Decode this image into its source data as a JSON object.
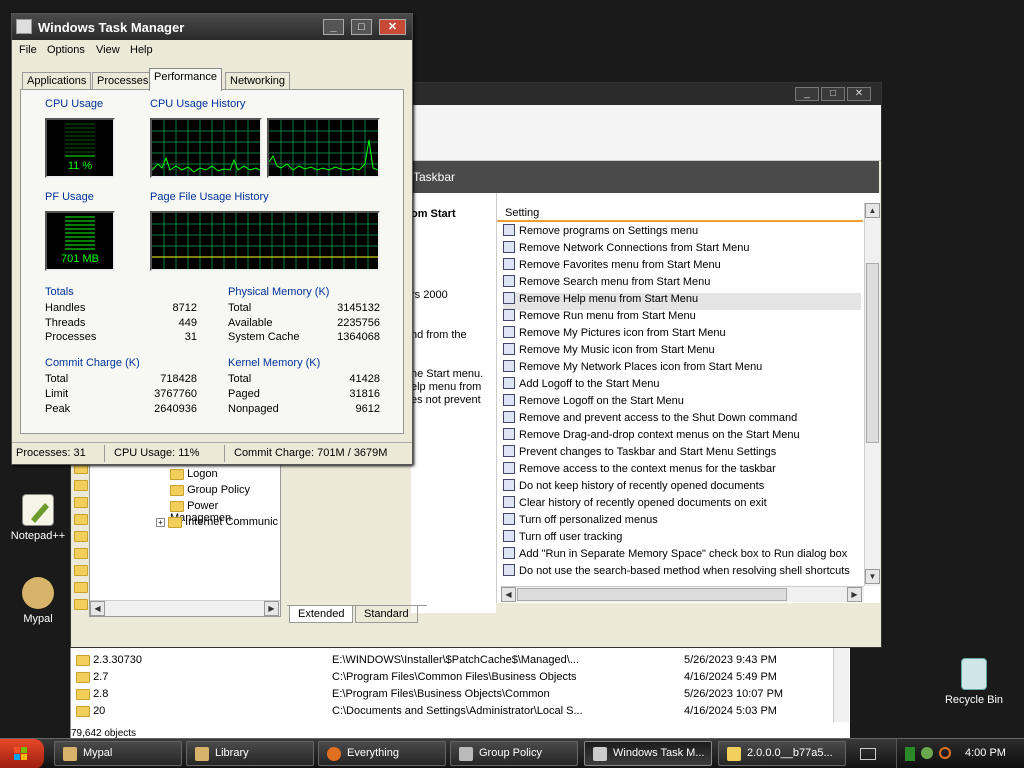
{
  "desktop": {
    "icons": [
      {
        "label": "Notepad++"
      },
      {
        "label": "Mypal"
      },
      {
        "label": "Recycle Bin"
      }
    ]
  },
  "explorer": {
    "rows": [
      {
        "name": "2.3.30730",
        "path": "E:\\WINDOWS\\Installer\\$PatchCache$\\Managed\\...",
        "date": "5/26/2023 9:43 PM"
      },
      {
        "name": "2.7",
        "path": "C:\\Program Files\\Common Files\\Business Objects",
        "date": "4/16/2024 5:49 PM"
      },
      {
        "name": "2.8",
        "path": "E:\\Program Files\\Business Objects\\Common",
        "date": "5/26/2023 10:07 PM"
      },
      {
        "name": "20",
        "path": "C:\\Documents and Settings\\Administrator\\Local S...",
        "date": "4/16/2024 5:03 PM"
      }
    ],
    "status": "79,642 objects"
  },
  "gpe": {
    "header": "Taskbar",
    "desc_fragments": [
      "om Start",
      "rs 2000",
      "nd from the",
      "he Start menu.",
      "elp menu from",
      "es not prevent"
    ],
    "column_setting": "Setting",
    "settings": [
      "Remove programs on Settings menu",
      "Remove Network Connections from Start Menu",
      "Remove Favorites menu from Start Menu",
      "Remove Search menu from Start Menu",
      "Remove Help menu from Start Menu",
      "Remove Run menu from Start Menu",
      "Remove My Pictures icon from Start Menu",
      "Remove My Music icon from Start Menu",
      "Remove My Network Places icon from Start Menu",
      "Add Logoff to the Start Menu",
      "Remove Logoff on the Start Menu",
      "Remove and prevent access to the Shut Down command",
      "Remove Drag-and-drop context menus on the Start Menu",
      "Prevent changes to Taskbar and Start Menu Settings",
      "Remove access to the context menus for the taskbar",
      "Do not keep history of recently opened documents",
      "Clear history of recently opened documents on exit",
      "Turn off personalized menus",
      "Turn off user tracking",
      "Add \"Run in Separate Memory Space\" check box to Run dialog box",
      "Do not use the search-based method when resolving shell shortcuts"
    ],
    "selected_index": 4,
    "tree": [
      "Logon",
      "Group Policy",
      "Power Managemen",
      "Internet Communic"
    ],
    "bottom_tabs": [
      "Extended",
      "Standard"
    ]
  },
  "taskmgr": {
    "title": "Windows Task Manager",
    "menu": [
      "File",
      "Options",
      "View",
      "Help"
    ],
    "tabs": [
      "Applications",
      "Processes",
      "Performance",
      "Networking"
    ],
    "active_tab": "Performance",
    "cpu_usage_label": "CPU Usage",
    "cpu_usage_value": "11 %",
    "cpu_history_label": "CPU Usage History",
    "pf_usage_label": "PF Usage",
    "pf_usage_value": "701 MB",
    "pf_history_label": "Page File Usage History",
    "totals": {
      "title": "Totals",
      "handles_label": "Handles",
      "handles": "8712",
      "threads_label": "Threads",
      "threads": "449",
      "processes_label": "Processes",
      "processes": "31"
    },
    "physical": {
      "title": "Physical Memory (K)",
      "total_label": "Total",
      "total": "3145132",
      "available_label": "Available",
      "available": "2235756",
      "cache_label": "System Cache",
      "cache": "1364068"
    },
    "commit": {
      "title": "Commit Charge (K)",
      "total_label": "Total",
      "total": "718428",
      "limit_label": "Limit",
      "limit": "3767760",
      "peak_label": "Peak",
      "peak": "2640936"
    },
    "kernel": {
      "title": "Kernel Memory (K)",
      "total_label": "Total",
      "total": "41428",
      "paged_label": "Paged",
      "paged": "31816",
      "nonpaged_label": "Nonpaged",
      "nonpaged": "9612"
    },
    "status": {
      "processes": "Processes: 31",
      "cpu": "CPU Usage: 11%",
      "commit": "Commit Charge: 701M / 3679M"
    }
  },
  "taskbar": {
    "tasks": [
      "Mypal",
      "Library",
      "Everything",
      "Group Policy",
      "Windows Task M...",
      "2.0.0.0__b77a5..."
    ],
    "active_task": "Windows Task M...",
    "clock": "4:00 PM"
  },
  "colors": {
    "graph_green": "#00ff00",
    "accent_blue": "#003399"
  }
}
